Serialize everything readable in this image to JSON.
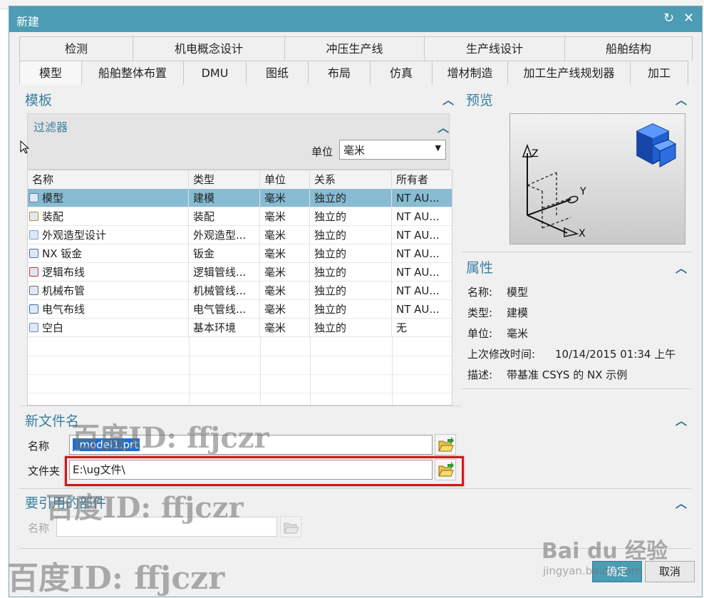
{
  "dialog": {
    "title": "新建",
    "refresh_icon": "refresh-icon",
    "close_icon": "close-icon"
  },
  "tabs_row1": [
    "检测",
    "机电概念设计",
    "冲压生产线",
    "生产线设计",
    "船舶结构"
  ],
  "tabs_row2": [
    "模型",
    "船舶整体布置",
    "DMU",
    "图纸",
    "布局",
    "仿真",
    "增材制造",
    "加工生产线规划器",
    "加工"
  ],
  "template": {
    "title": "模板",
    "filter": {
      "title": "过滤器",
      "unit_label": "单位",
      "unit_value": "毫米"
    },
    "columns": [
      "名称",
      "类型",
      "单位",
      "关系",
      "所有者"
    ],
    "rows": [
      [
        "模型",
        "建模",
        "毫米",
        "独立的",
        "NT AU..."
      ],
      [
        "装配",
        "装配",
        "毫米",
        "独立的",
        "NT AU..."
      ],
      [
        "外观造型设计",
        "外观造型...",
        "毫米",
        "独立的",
        "NT AU..."
      ],
      [
        "NX 钣金",
        "钣金",
        "毫米",
        "独立的",
        "NT AU..."
      ],
      [
        "逻辑布线",
        "逻辑管线...",
        "毫米",
        "独立的",
        "NT AU..."
      ],
      [
        "机械布管",
        "机械管线...",
        "毫米",
        "独立的",
        "NT AU..."
      ],
      [
        "电气布线",
        "电气管线...",
        "毫米",
        "独立的",
        "NT AU..."
      ],
      [
        "空白",
        "基本环境",
        "毫米",
        "独立的",
        "无"
      ]
    ]
  },
  "preview": {
    "title": "预览",
    "axis_x": "X",
    "axis_y": "Y",
    "axis_z": "Z"
  },
  "properties": {
    "title": "属性",
    "name_label": "名称:",
    "name_value": "模型",
    "type_label": "类型:",
    "type_value": "建模",
    "unit_label": "单位:",
    "unit_value": "毫米",
    "modified_label": "上次修改时间:",
    "modified_value": "10/14/2015 01:34 上午",
    "desc_label": "描述:",
    "desc_value": "带基准 CSYS 的 NX 示例"
  },
  "new_file": {
    "title": "新文件名",
    "name_label": "名称",
    "name_value": "_model1.prt",
    "folder_label": "文件夹",
    "folder_value": "E:\\ug文件\\"
  },
  "ref_part": {
    "title": "要引用的部件",
    "name_label": "名称",
    "name_value": ""
  },
  "buttons": {
    "ok": "确定",
    "cancel": "取消"
  },
  "watermark": {
    "text": "百度ID: ffjczr",
    "site": "jingyan.baidu.com",
    "brand": "Bai du 经验"
  },
  "colors": {
    "titlebar": "#4b9cb4",
    "selection": "#87bcd3",
    "section": "#3a7fa0",
    "highlight": "#d9141a"
  }
}
